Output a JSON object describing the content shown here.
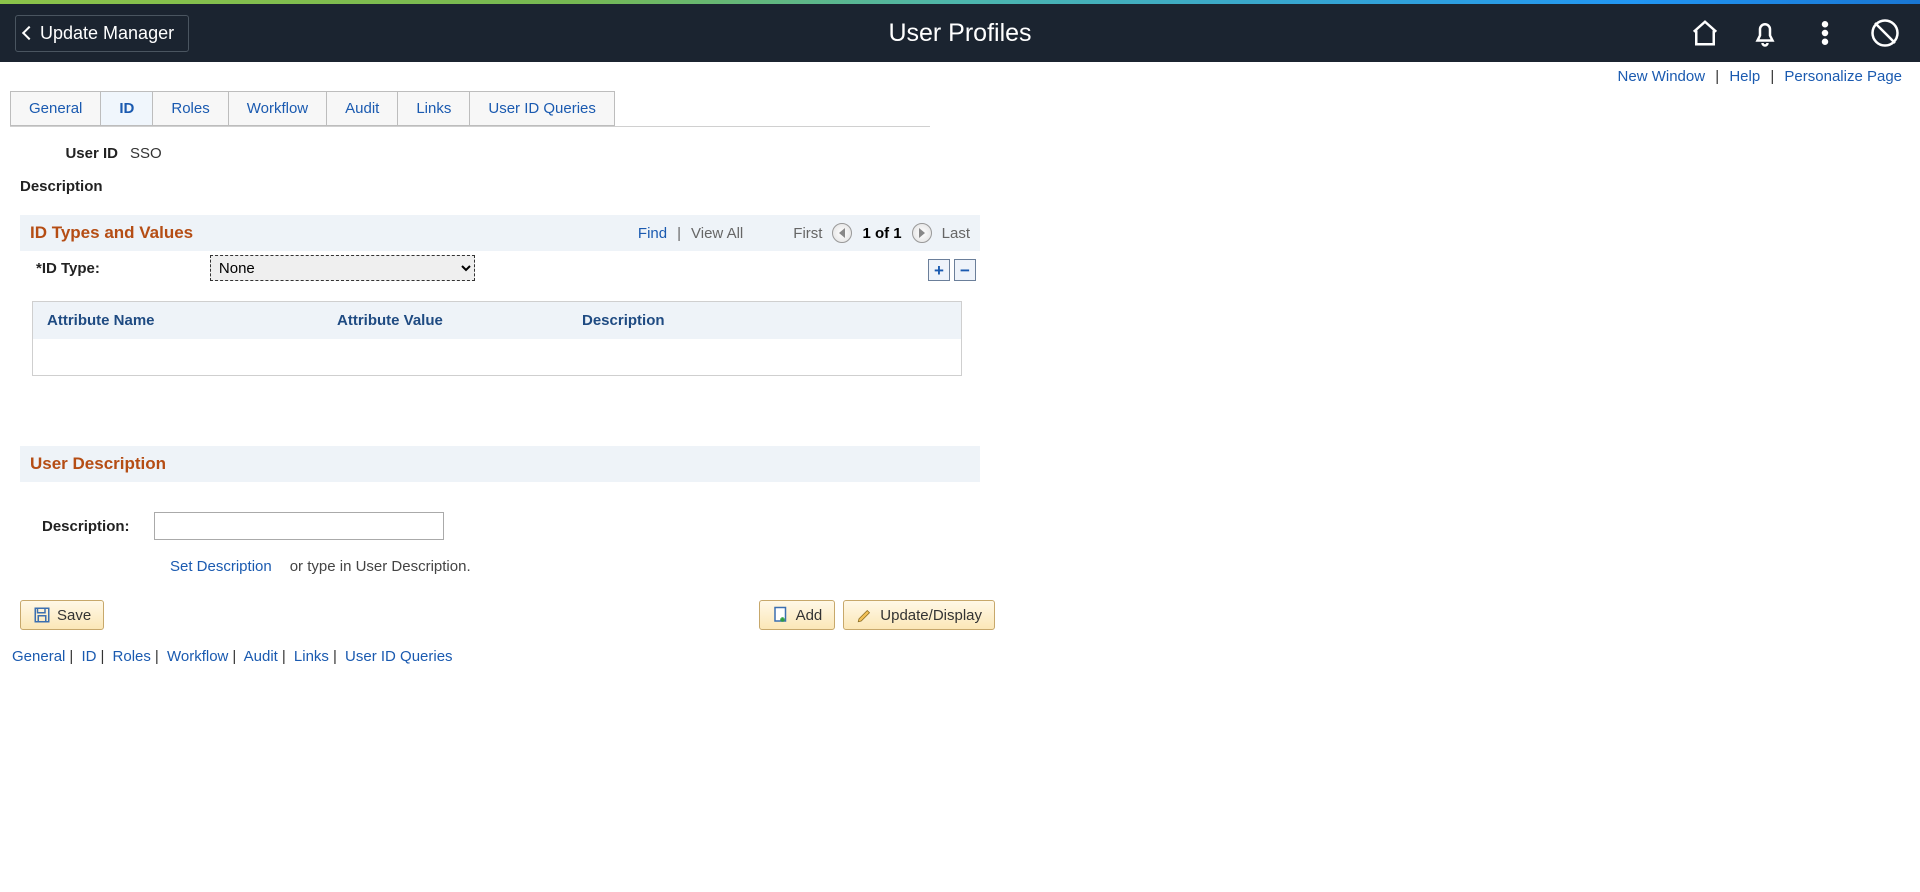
{
  "header": {
    "back_label": "Update Manager",
    "title": "User Profiles"
  },
  "util_links": {
    "new_window": "New Window",
    "help": "Help",
    "personalize": "Personalize Page"
  },
  "tabs": [
    "General",
    "ID",
    "Roles",
    "Workflow",
    "Audit",
    "Links",
    "User ID Queries"
  ],
  "active_tab_index": 1,
  "user": {
    "id_label": "User ID",
    "id_value": "SSO",
    "description_label": "Description"
  },
  "section": {
    "title": "ID Types and Values",
    "find": "Find",
    "view_all": "View All",
    "first": "First",
    "counter": "1 of 1",
    "last": "Last"
  },
  "id_type": {
    "label": "*ID Type:",
    "selected": "None"
  },
  "grid": {
    "col1": "Attribute Name",
    "col2": "Attribute Value",
    "col3": "Description"
  },
  "user_desc": {
    "title": "User Description",
    "label": "Description:",
    "value": "",
    "set_link": "Set Description",
    "hint": "or type in User Description."
  },
  "buttons": {
    "save": "Save",
    "add": "Add",
    "update": "Update/Display"
  },
  "footer_links": [
    "General",
    "ID",
    "Roles",
    "Workflow",
    "Audit",
    "Links",
    "User ID Queries"
  ]
}
